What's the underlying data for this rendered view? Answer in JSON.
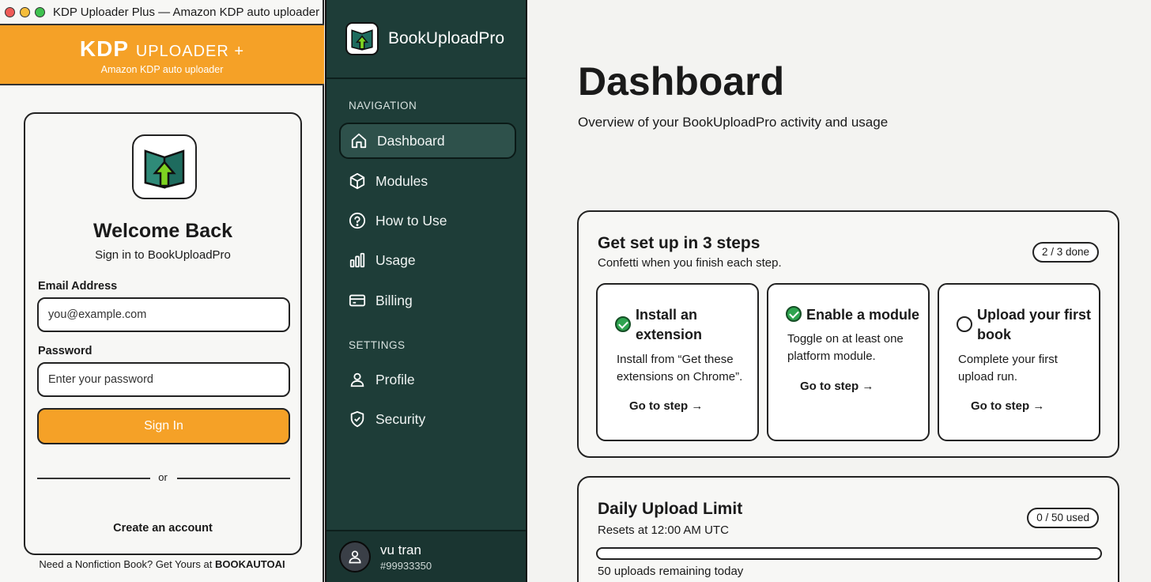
{
  "popup": {
    "window_title": "KDP Uploader Plus — Amazon KDP auto uploader",
    "brand_main": "KDP",
    "brand_rest": "UPLOADER +",
    "brand_sub": "Amazon KDP auto uploader",
    "welcome": "Welcome Back",
    "welcome_sub": "Sign in to BookUploadPro",
    "email_label": "Email Address",
    "email_placeholder": "you@example.com",
    "password_label": "Password",
    "password_placeholder": "Enter your password",
    "sign_in": "Sign In",
    "or": "or",
    "create_account": "Create an account",
    "footer_text": "Need a Nonfiction Book? Get Yours at ",
    "footer_brand": "BOOKAUTOAI"
  },
  "sidebar": {
    "app_name": "BookUploadPro",
    "nav_heading": "NAVIGATION",
    "nav": [
      {
        "label": "Dashboard",
        "icon": "home-icon",
        "active": true
      },
      {
        "label": "Modules",
        "icon": "cube-icon"
      },
      {
        "label": "How to Use",
        "icon": "help-circle-icon"
      },
      {
        "label": "Usage",
        "icon": "bar-chart-icon"
      },
      {
        "label": "Billing",
        "icon": "credit-card-icon"
      }
    ],
    "settings_heading": "SETTINGS",
    "settings": [
      {
        "label": "Profile",
        "icon": "user-icon"
      },
      {
        "label": "Security",
        "icon": "shield-check-icon"
      }
    ],
    "user": {
      "name": "vu tran",
      "id": "#99933350"
    }
  },
  "main": {
    "title": "Dashboard",
    "subtitle": "Overview of your BookUploadPro activity and usage",
    "setup": {
      "title": "Get set up in 3 steps",
      "subtitle": "Confetti when you finish each step.",
      "progress": "2 / 3 done",
      "steps": [
        {
          "title": "Install an extension",
          "desc": "Install from “Get these extensions on Chrome”.",
          "action": "Go to step →",
          "done": true
        },
        {
          "title": "Enable a module",
          "desc": "Toggle on at least one platform module.",
          "action": "Go to step →",
          "done": true
        },
        {
          "title": "Upload your first book",
          "desc": "Complete your first upload run.",
          "action": "Go to step →",
          "done": false
        }
      ]
    },
    "limit": {
      "title": "Daily Upload Limit",
      "subtitle": "Resets at 12:00 AM UTC",
      "used": "0 / 50 used",
      "used_fraction": 0,
      "remaining": "50 uploads remaining today"
    }
  },
  "colors": {
    "accent": "#f5a127",
    "sidebar": "#1e3d38",
    "success": "#2ea44f"
  }
}
